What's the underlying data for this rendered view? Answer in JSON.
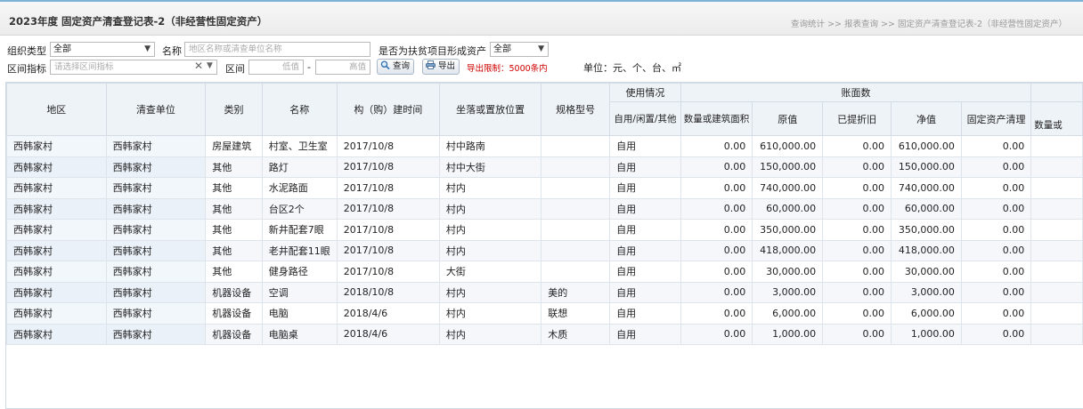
{
  "page": {
    "title": "2023年度 固定资产清查登记表-2（非经营性固定资产）",
    "breadcrumb": [
      "查询统计",
      ">>",
      "报表查询",
      ">>",
      "固定资产清查登记表-2（非经营性固定资产）"
    ]
  },
  "filters": {
    "org_type_label": "组织类型",
    "org_type_value": "全部",
    "name_label": "名称",
    "name_placeholder": "地区名称或清查单位名称",
    "poverty_label": "是否为扶贫项目形成资产",
    "poverty_value": "全部",
    "range_label": "区间指标",
    "range_placeholder": "请选择区间指标",
    "interval_label": "区间",
    "low_placeholder": "低值",
    "dash": "-",
    "high_placeholder": "高值",
    "search_button": "查询",
    "export_button": "导出",
    "export_limit": "导出限制：5000条内",
    "unit_text": "单位：元、个、台、㎡"
  },
  "table": {
    "headers": {
      "region": "地区",
      "unit": "清查单位",
      "category": "类别",
      "name": "名称",
      "build_time": "构（购）建时间",
      "location": "坐落或置放位置",
      "spec": "规格型号",
      "usage_group": "使用情况",
      "usage": "自用/闲置/其他",
      "book_group": "账面数",
      "qty_area": "数量或建筑面积",
      "original_value": "原值",
      "depreciation": "已提折旧",
      "net_value": "净值",
      "fixed_asset_cleanup": "固定资产清理",
      "qty_next": "数量或"
    },
    "rows": [
      [
        "西韩家村",
        "西韩家村",
        "房屋建筑",
        "村室、卫生室",
        "2017/10/8",
        "村中路南",
        "",
        "自用",
        "0.00",
        "610,000.00",
        "0.00",
        "610,000.00",
        "0.00"
      ],
      [
        "西韩家村",
        "西韩家村",
        "其他",
        "路灯",
        "2017/10/8",
        "村中大街",
        "",
        "自用",
        "0.00",
        "150,000.00",
        "0.00",
        "150,000.00",
        "0.00"
      ],
      [
        "西韩家村",
        "西韩家村",
        "其他",
        "水泥路面",
        "2017/10/8",
        "村内",
        "",
        "自用",
        "0.00",
        "740,000.00",
        "0.00",
        "740,000.00",
        "0.00"
      ],
      [
        "西韩家村",
        "西韩家村",
        "其他",
        "台区2个",
        "2017/10/8",
        "村内",
        "",
        "自用",
        "0.00",
        "60,000.00",
        "0.00",
        "60,000.00",
        "0.00"
      ],
      [
        "西韩家村",
        "西韩家村",
        "其他",
        "新井配套7眼",
        "2017/10/8",
        "村内",
        "",
        "自用",
        "0.00",
        "350,000.00",
        "0.00",
        "350,000.00",
        "0.00"
      ],
      [
        "西韩家村",
        "西韩家村",
        "其他",
        "老井配套11眼",
        "2017/10/8",
        "村内",
        "",
        "自用",
        "0.00",
        "418,000.00",
        "0.00",
        "418,000.00",
        "0.00"
      ],
      [
        "西韩家村",
        "西韩家村",
        "其他",
        "健身路径",
        "2017/10/8",
        "大街",
        "",
        "自用",
        "0.00",
        "30,000.00",
        "0.00",
        "30,000.00",
        "0.00"
      ],
      [
        "西韩家村",
        "西韩家村",
        "机器设备",
        "空调",
        "2018/10/8",
        "村内",
        "美的",
        "自用",
        "0.00",
        "3,000.00",
        "0.00",
        "3,000.00",
        "0.00"
      ],
      [
        "西韩家村",
        "西韩家村",
        "机器设备",
        "电脑",
        "2018/4/6",
        "村内",
        "联想",
        "自用",
        "0.00",
        "6,000.00",
        "0.00",
        "6,000.00",
        "0.00"
      ],
      [
        "西韩家村",
        "西韩家村",
        "机器设备",
        "电脑桌",
        "2018/4/6",
        "村内",
        "木质",
        "自用",
        "0.00",
        "1,000.00",
        "0.00",
        "1,000.00",
        "0.00"
      ]
    ]
  },
  "colors": {
    "accent_border": "#7fb3d6",
    "header_bg": "#eef3f8",
    "warning_text": "#d00000"
  },
  "icons": {
    "dropdown": "chevron-down-icon",
    "clear": "clear-x-icon",
    "search": "magnifier-icon",
    "export": "printer-icon"
  }
}
